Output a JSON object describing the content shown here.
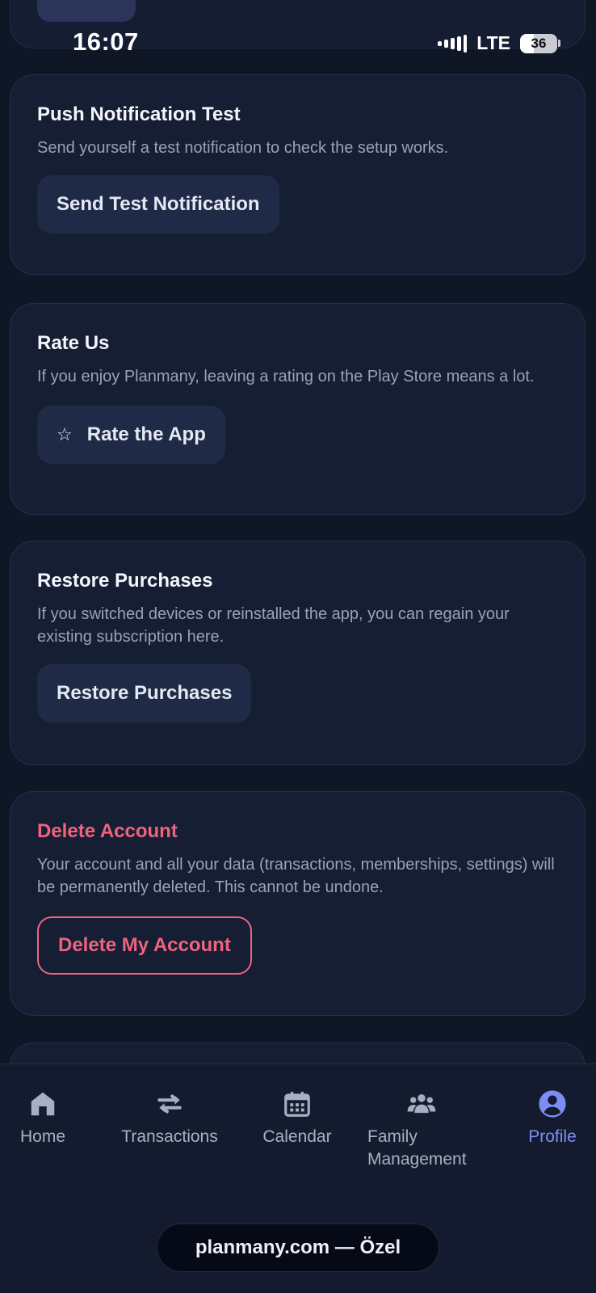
{
  "status_bar": {
    "time": "16:07",
    "network": "LTE",
    "battery_level": "36"
  },
  "cards": {
    "push": {
      "title": "Push Notification Test",
      "description": "Send yourself a test notification to check the setup works.",
      "button_label": "Send Test Notification"
    },
    "rate": {
      "title": "Rate Us",
      "description": "If you enjoy Planmany, leaving a rating on the Play Store means a lot.",
      "button_icon": "star-icon",
      "button_label": "Rate the App"
    },
    "restore": {
      "title": "Restore Purchases",
      "description": "If you switched devices or reinstalled the app, you can regain your existing subscription here.",
      "button_label": "Restore Purchases"
    },
    "delete": {
      "title": "Delete Account",
      "description": "Your account and all your data (transactions, memberships, settings) will be permanently deleted. This cannot be undone.",
      "button_label": "Delete My Account"
    }
  },
  "nav": {
    "items": [
      {
        "label": "Home",
        "icon": "home-icon"
      },
      {
        "label": "Transactions",
        "icon": "transfer-arrows-icon"
      },
      {
        "label": "Calendar",
        "icon": "calendar-icon"
      },
      {
        "label": "Family\nManagement",
        "icon": "family-icon"
      },
      {
        "label": "Profile",
        "icon": "profile-icon",
        "active": true
      }
    ]
  },
  "browser": {
    "url_label": "planmany.com — Özel"
  },
  "colors": {
    "background": "#0f1626",
    "card": "#151e33",
    "danger": "#f0637f",
    "active_nav": "#7e8df5"
  }
}
